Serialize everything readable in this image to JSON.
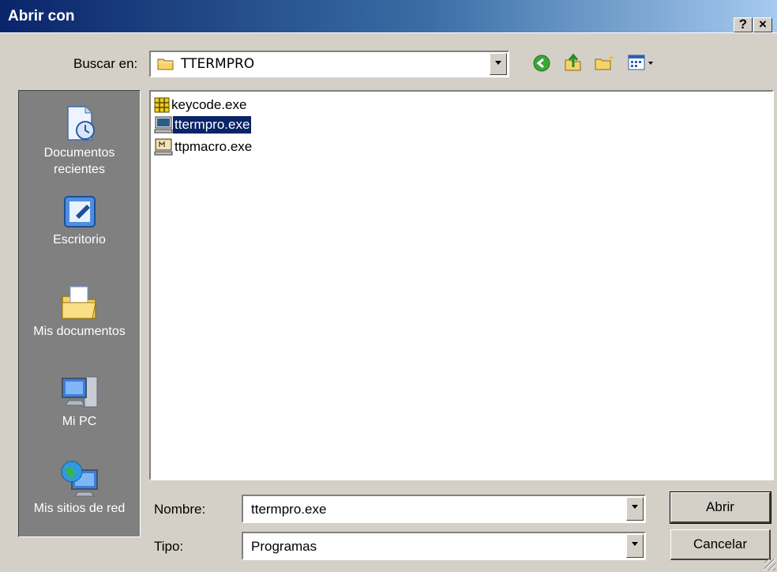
{
  "window": {
    "title": "Abrir con",
    "help_label": "?",
    "close_label": "×"
  },
  "look_in": {
    "label": "Buscar en:",
    "value": "TTERMPRO"
  },
  "toolbar": {
    "icons": [
      "back-icon",
      "up-folder-icon",
      "new-folder-icon",
      "view-menu-icon"
    ]
  },
  "places": [
    {
      "label": "Documentos recientes",
      "icon": "recent-documents-icon"
    },
    {
      "label": "Escritorio",
      "icon": "desktop-icon"
    },
    {
      "label": "Mis documentos",
      "icon": "my-documents-icon"
    },
    {
      "label": "Mi PC",
      "icon": "my-computer-icon"
    },
    {
      "label": "Mis sitios de red",
      "icon": "network-places-icon"
    }
  ],
  "files": [
    {
      "name": "keycode.exe",
      "icon": "keycode-app-icon",
      "selected": false
    },
    {
      "name": "ttermpro.exe",
      "icon": "terminal-app-icon",
      "selected": true
    },
    {
      "name": "ttpmacro.exe",
      "icon": "macro-app-icon",
      "selected": false
    }
  ],
  "filename": {
    "label": "Nombre:",
    "value": "ttermpro.exe"
  },
  "filetype": {
    "label": "Tipo:",
    "value": "Programas"
  },
  "buttons": {
    "open_label": "Abrir",
    "cancel_label": "Cancelar"
  },
  "colors": {
    "title_start": "#0a246a",
    "title_end": "#a6caf0",
    "selection": "#0a246a",
    "face": "#d4d0c8"
  }
}
